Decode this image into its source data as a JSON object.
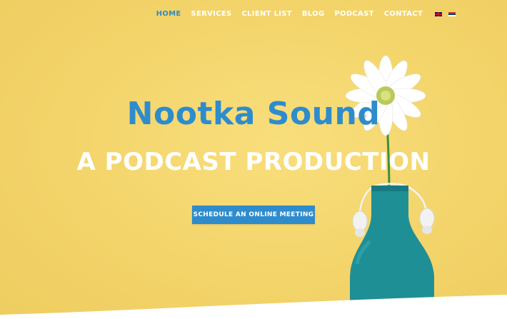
{
  "nav": {
    "items": [
      {
        "label": "HOME",
        "active": true
      },
      {
        "label": "SERVICES",
        "active": false
      },
      {
        "label": "CLIENT LIST",
        "active": false
      },
      {
        "label": "BLOG",
        "active": false
      },
      {
        "label": "PODCAST",
        "active": false
      },
      {
        "label": "CONTACT",
        "active": false
      }
    ],
    "languages": [
      "english-flag-icon",
      "serbian-flag-icon"
    ]
  },
  "hero": {
    "title": "Nootka Sound",
    "subtitle": "A PODCAST PRODUCTION",
    "cta_label": "SCHEDULE AN ONLINE MEETING"
  },
  "colors": {
    "background": "#f3d46a",
    "accent": "#2e8ccc",
    "text_light": "#ffffff",
    "bottle": "#1f8f96"
  }
}
